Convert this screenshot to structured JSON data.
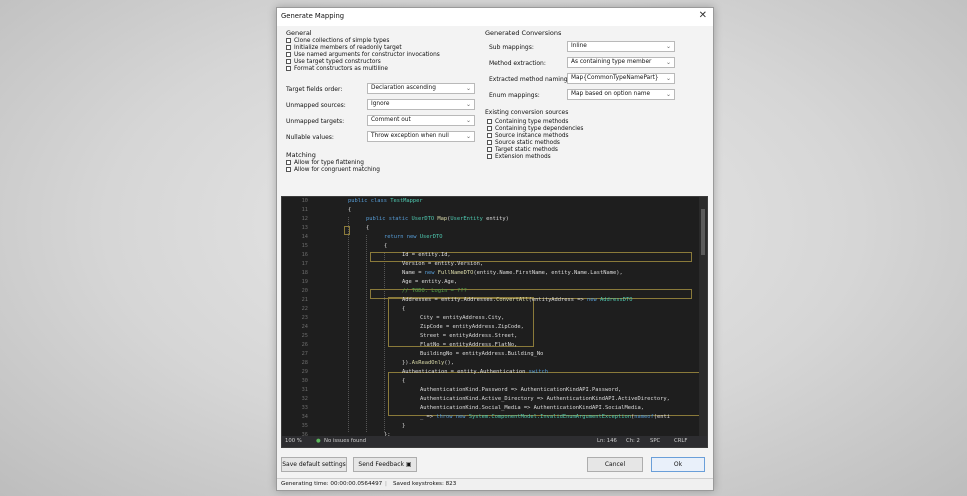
{
  "dialog": {
    "title": "Generate Mapping",
    "close": "✕"
  },
  "general": {
    "heading": "General",
    "checks": [
      "Clone collections of simple types",
      "Initialize members of readonly target",
      "Use named arguments for constructor invocations",
      "Use target typed constructors",
      "Format constructors as multiline"
    ],
    "fields": [
      {
        "label": "Target fields order:",
        "value": "Declaration ascending"
      },
      {
        "label": "Unmapped sources:",
        "value": "Ignore"
      },
      {
        "label": "Unmapped targets:",
        "value": "Comment out"
      },
      {
        "label": "Nullable values:",
        "value": "Throw exception when null"
      }
    ]
  },
  "matching": {
    "heading": "Matching",
    "checks": [
      "Allow for type flattening",
      "Allow for congruent matching"
    ]
  },
  "conversions": {
    "heading": "Generated Conversions",
    "fields": [
      {
        "label": "Sub mappings:",
        "value": "Inline"
      },
      {
        "label": "Method extraction:",
        "value": "As containing type member"
      },
      {
        "label": "Extracted method naming:",
        "value": "Map{CommonTypeNamePart}"
      },
      {
        "label": "Enum mappings:",
        "value": "Map based on option name"
      }
    ]
  },
  "existing": {
    "heading": "Existing conversion sources",
    "checks": [
      "Containing type methods",
      "Containing type dependencies",
      "Source instance methods",
      "Source static methods",
      "Target static methods",
      "Extension methods"
    ]
  },
  "editor": {
    "line_numbers": [
      "10",
      "11",
      "12",
      "13",
      "14",
      "15",
      "16",
      "17",
      "18",
      "19",
      "20",
      "21",
      "22",
      "23",
      "24",
      "25",
      "26",
      "27",
      "28",
      "29",
      "30",
      "31",
      "32",
      "33",
      "34",
      "35",
      "36",
      "37"
    ],
    "status": {
      "zoom": "100 %",
      "issues": "No issues found",
      "position": "Ln: 146",
      "column": "Ch: 2",
      "spacing": "SPC",
      "line_ending": "CRLF"
    }
  },
  "buttons": {
    "save_defaults": "Save default settings",
    "feedback": "Send Feedback",
    "cancel": "Cancel",
    "ok": "Ok"
  },
  "footer": {
    "generating_time": "Generating time: 00:00:00.0564497",
    "saved_keystrokes": "Saved keystrokes: 823"
  },
  "colors": {
    "accent": "#6a9fd9",
    "editor_bg": "#1e1e1e",
    "keyword": "#569cd6",
    "type": "#4ec9b0",
    "comment": "#57a64a"
  }
}
